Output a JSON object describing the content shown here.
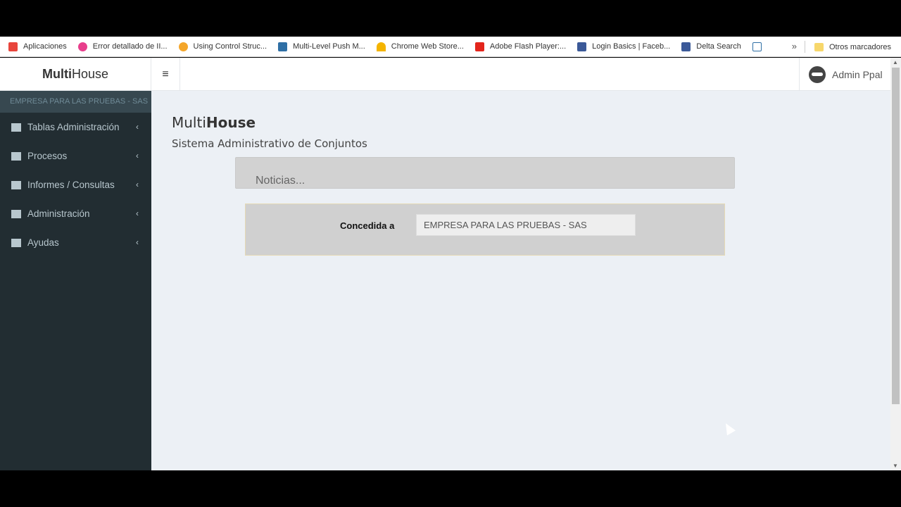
{
  "bookmarks": {
    "items": [
      {
        "label": "Aplicaciones",
        "icon": "apps-grid-icon",
        "color": "#e8453c"
      },
      {
        "label": "Error detallado de II...",
        "icon": "error-page-icon",
        "color": "#e83e8c"
      },
      {
        "label": "Using Control Struc...",
        "icon": "dots-icon",
        "color": "#f4a62a"
      },
      {
        "label": "Multi-Level Push M...",
        "icon": "drop-icon",
        "color": "#2f6fa5"
      },
      {
        "label": "Chrome Web Store...",
        "icon": "rainbow-icon",
        "color": "#f4b400"
      },
      {
        "label": "Adobe Flash Player:...",
        "icon": "adobe-icon",
        "color": "#e3251c"
      },
      {
        "label": "Login Basics | Faceb...",
        "icon": "facebook-icon",
        "color": "#3b5998"
      },
      {
        "label": "Delta Search",
        "icon": "facebook-icon",
        "color": "#3b5998"
      }
    ],
    "more": "»",
    "other": "Otros marcadores"
  },
  "header": {
    "logo_bold": "Multi",
    "logo_rest": "House",
    "toggle_icon": "≡",
    "user_name": "Admin Ppal"
  },
  "sidebar": {
    "company": "EMPRESA PARA LAS PRUEBAS - SAS",
    "items": [
      {
        "label": "Tablas Administración",
        "icon": "archive-icon"
      },
      {
        "label": "Procesos",
        "icon": "copy-icon"
      },
      {
        "label": "Informes / Consultas",
        "icon": "file-icon"
      },
      {
        "label": "Administración",
        "icon": "bank-icon"
      },
      {
        "label": "Ayudas",
        "icon": "coffee-icon"
      }
    ],
    "chevron": "‹"
  },
  "main": {
    "title_light": "Multi",
    "title_bold": "House",
    "subtitle": "Sistema Administrativo de Conjuntos",
    "news": "Noticias...",
    "grant_label": "Concedida a",
    "grant_value": "EMPRESA PARA LAS PRUEBAS - SAS"
  }
}
